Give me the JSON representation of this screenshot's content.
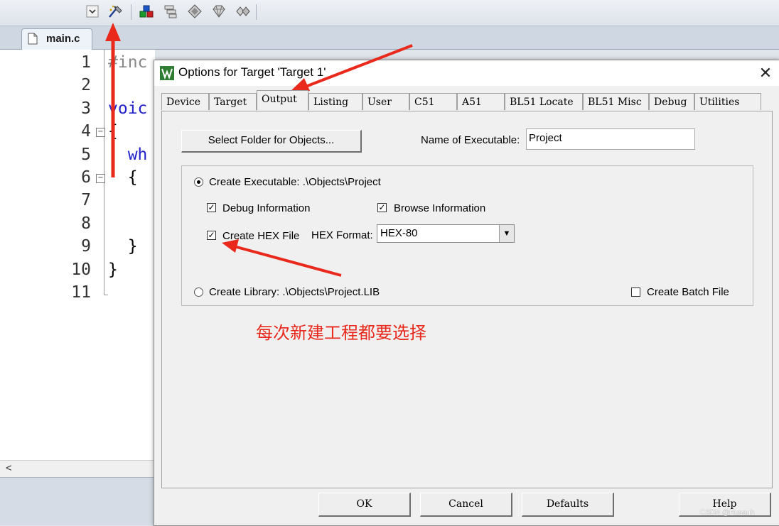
{
  "editor": {
    "file_tab": "main.c",
    "line_numbers": [
      "1",
      "2",
      "3",
      "4",
      "5",
      "6",
      "7",
      "8",
      "9",
      "10",
      "11"
    ],
    "code_lines": [
      {
        "text": "#inc",
        "color": "#888888"
      },
      {
        "text": "",
        "color": "#000000"
      },
      {
        "text": "voic",
        "color": "#2222cc"
      },
      {
        "text": "{",
        "color": "#000000"
      },
      {
        "text": "  wh",
        "color": "#2222cc"
      },
      {
        "text": "  {",
        "color": "#000000"
      },
      {
        "text": "",
        "color": "#000000"
      },
      {
        "text": "",
        "color": "#000000"
      },
      {
        "text": "  }",
        "color": "#000000"
      },
      {
        "text": "}",
        "color": "#000000"
      },
      {
        "text": "",
        "color": "#000000"
      }
    ],
    "scroll_left": "<"
  },
  "dialog": {
    "title": "Options for Target 'Target 1'",
    "close": "✕",
    "tabs": [
      "Device",
      "Target",
      "Output",
      "Listing",
      "User",
      "C51",
      "A51",
      "BL51 Locate",
      "BL51 Misc",
      "Debug",
      "Utilities"
    ],
    "active_tab": "Output",
    "select_folder_btn": "Select Folder for Objects...",
    "name_exec_label": "Name of Executable:",
    "name_exec_value": "Project",
    "create_exec_label": "Create Executable:  .\\Objects\\Project",
    "debug_info": "Debug Information",
    "browse_info": "Browse Information",
    "create_hex": "Create HEX File",
    "hex_format_label": "HEX Format:",
    "hex_format_value": "HEX-80",
    "create_lib_label": "Create Library:  .\\Objects\\Project.LIB",
    "create_batch": "Create Batch File",
    "footer_buttons": [
      "OK",
      "Cancel",
      "Defaults",
      "Help"
    ],
    "checkmark": "✓"
  },
  "annotation": "每次新建工程都要选择",
  "watermark": "CSDN @Huaauh",
  "colors": {
    "arrow_red": "#e8291c"
  }
}
